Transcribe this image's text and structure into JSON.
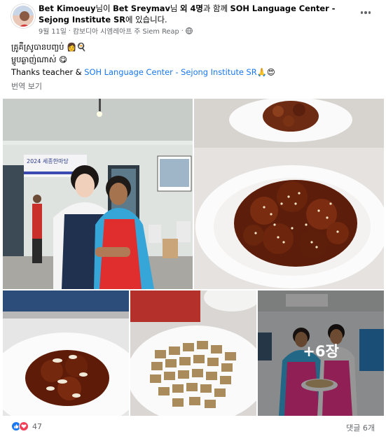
{
  "header": {
    "author": "Bet Kimoeuy",
    "connector1": "님이",
    "tagged": "Bet Sreymav",
    "connector2": "님",
    "others": "외 4명",
    "connector3": "과 함께",
    "page": "SOH Language Center - Sejong Institute SR",
    "connector4": "에 있습니다.",
    "date": "9월 11일",
    "location": "캄보디아 시엠레아프 주 Siem Reap",
    "separator": "·",
    "privacy_icon": "globe-icon",
    "more_icon": "more-options-icon"
  },
  "post": {
    "line1": "គ្រូគឺស្រូបានបញ្ចប់ 👩‍🍳",
    "line2": "ម្ហូបឆ្ងាញ់ណាស់ 😋",
    "line3_prefix": "Thanks teacher & ",
    "line3_link": "SOH Language Center - Sejong Institute SR",
    "line3_suffix": "🙏😍",
    "translate_label": "번역 보기"
  },
  "photos": {
    "banner_text": "2024 세종한마당",
    "extra_count": "+6장"
  },
  "footer": {
    "reaction_count": "47",
    "comment_count": "댓글 6개",
    "like_color": "#1877f2",
    "love_color": "#f33e58"
  },
  "colors": {
    "link": "#1877f2",
    "meta": "#65676b"
  }
}
